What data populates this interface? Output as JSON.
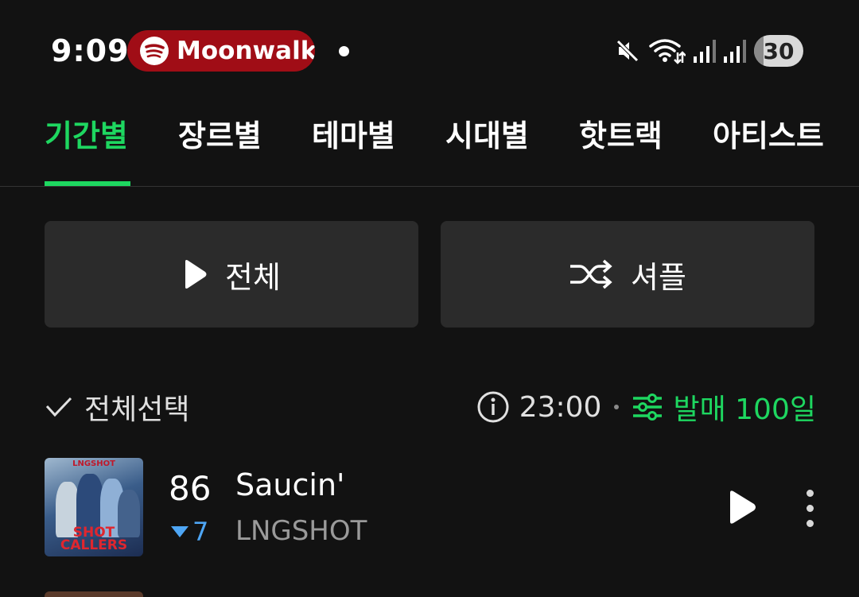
{
  "status_bar": {
    "time": "9:09",
    "now_playing": "Moonwalk",
    "battery": "30",
    "icons": [
      "spotify-icon",
      "mute-icon",
      "wifi-icon",
      "signal-icon",
      "signal-icon",
      "battery-icon"
    ]
  },
  "tabs": [
    {
      "label": "기간별",
      "active": true
    },
    {
      "label": "장르별",
      "active": false
    },
    {
      "label": "테마별",
      "active": false
    },
    {
      "label": "시대별",
      "active": false
    },
    {
      "label": "핫트랙",
      "active": false
    },
    {
      "label": "아티스트",
      "active": false
    }
  ],
  "actions": {
    "play_all_label": "전체",
    "shuffle_label": "셔플"
  },
  "list_header": {
    "select_all_label": "전체선택",
    "time_label": "23:00",
    "filter_label": "발매 100일"
  },
  "tracks": [
    {
      "rank": "86",
      "change": "7",
      "change_direction": "down",
      "title": "Saucin'",
      "artist": "LNGSHOT",
      "cover_top_text": "LNGSHOT",
      "cover_bottom_text": "SHOT CALLERS"
    }
  ],
  "colors": {
    "background": "#121212",
    "accent": "#1ed760",
    "pill": "#a00d16",
    "button_bg": "#2b2b2b",
    "rank_down": "#4ea6f5"
  }
}
